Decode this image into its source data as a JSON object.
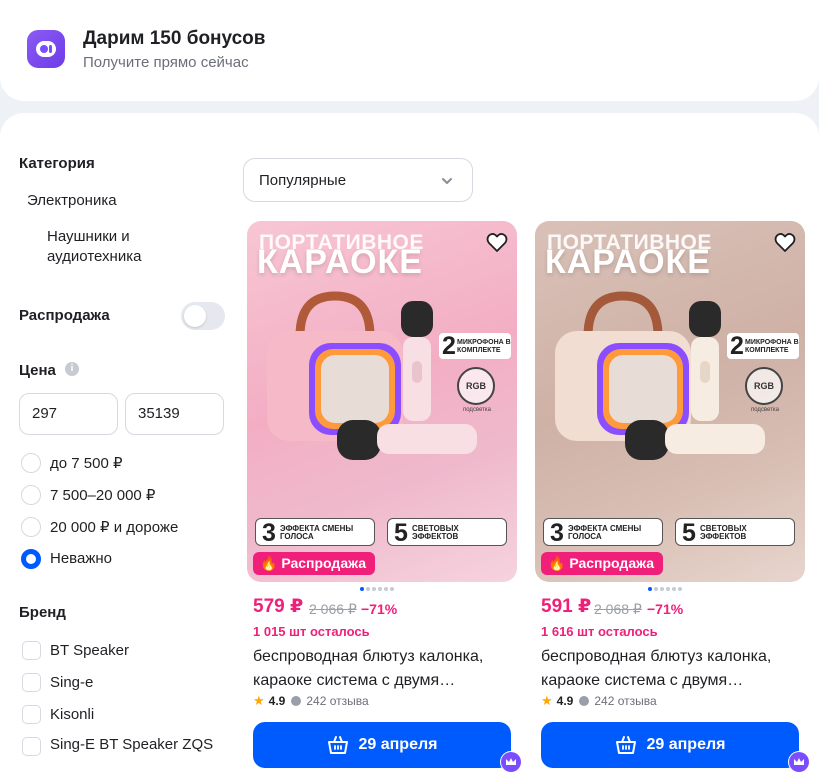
{
  "banner": {
    "title": "Дарим 150 бонусов",
    "subtitle": "Получите прямо сейчас"
  },
  "filters": {
    "category_heading": "Категория",
    "category_parent": "Электроника",
    "category_child": "Наушники и аудиотехника",
    "sale_label": "Распродажа",
    "sale_enabled": false,
    "price_heading": "Цена",
    "price_info_icon": "info-icon",
    "price_from": "297",
    "price_to": "35139",
    "price_options": [
      "до 7 500 ₽",
      "7 500–20 000 ₽",
      "20 000 ₽ и дороже",
      "Неважно"
    ],
    "price_selected": "Неважно",
    "brand_heading": "Бренд",
    "brands": [
      "BT Speaker",
      "Sing-e",
      "Kisonli",
      "Sing-E BT Speaker ZQS"
    ]
  },
  "sort": {
    "selected": "Популярные"
  },
  "colors": {
    "accent": "#005bff",
    "sale": "#f0207a",
    "banner_icon": "#7c4dff"
  },
  "products": [
    {
      "image_line1": "ПОРТАТИВНОЕ",
      "image_line2": "КАРАОКЕ",
      "mic_number": "2",
      "mic_text": "МИКРОФОНА В КОМПЛЕКТЕ",
      "rgb": "RGB",
      "rgb_sub": "подсветка",
      "feature1_num": "3",
      "feature1_text": "ЭФФЕКТА СМЕНЫ ГОЛОСА",
      "feature2_num": "5",
      "feature2_text": "СВЕТОВЫХ ЭФФЕКТОВ",
      "badge": "Распродажа",
      "price": "579 ₽",
      "old_price": "2 066 ₽",
      "discount": "−71%",
      "stock": "1 015 шт осталось",
      "title": "беспроводная блютуз калонка, караоке система с двумя…",
      "rating": "4.9",
      "reviews": "242 отзыва",
      "delivery": "29 апреля"
    },
    {
      "image_line1": "ПОРТАТИВНОЕ",
      "image_line2": "КАРАОКЕ",
      "mic_number": "2",
      "mic_text": "МИКРОФОНА В КОМПЛЕКТЕ",
      "rgb": "RGB",
      "rgb_sub": "подсветка",
      "feature1_num": "3",
      "feature1_text": "ЭФФЕКТА СМЕНЫ ГОЛОСА",
      "feature2_num": "5",
      "feature2_text": "СВЕТОВЫХ ЭФФЕКТОВ",
      "badge": "Распродажа",
      "price": "591 ₽",
      "old_price": "2 068 ₽",
      "discount": "−71%",
      "stock": "1 616 шт осталось",
      "title": "беспроводная блютуз калонка, караоке система с двумя…",
      "rating": "4.9",
      "reviews": "242 отзыва",
      "delivery": "29 апреля"
    }
  ]
}
